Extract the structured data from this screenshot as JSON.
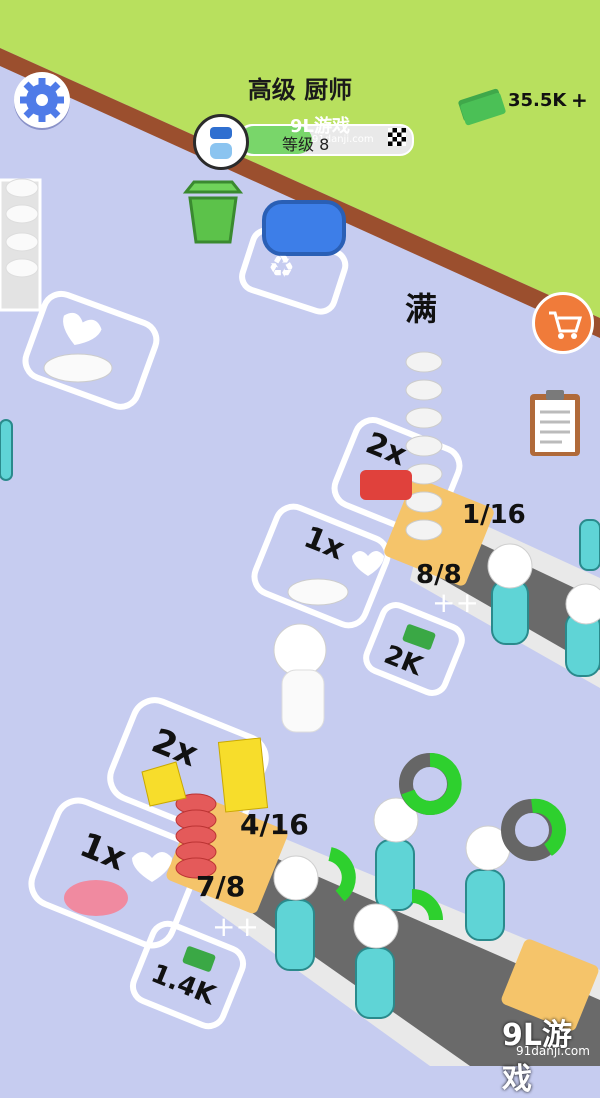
{
  "header": {
    "title": "高级 厨师",
    "rank_label": "等级 8",
    "rank_progress": 0.42,
    "money": "35.5K",
    "money_plus": "+"
  },
  "status": {
    "full_label": "满"
  },
  "stations": {
    "top_counter": "1/16",
    "top_tray": "8/8",
    "top_cost": "2K",
    "top_mult_a": "2x",
    "top_mult_b": "1x",
    "bottom_counter": "4/16",
    "bottom_tray": "7/8",
    "bottom_cost": "1.4K",
    "bottom_mult_a": "2x",
    "bottom_mult_b": "1x"
  },
  "watermark": {
    "top_logo": "9L游戏",
    "top_url": "91danji.com",
    "bottom_logo": "9L游戏",
    "bottom_url": "91danji.com"
  },
  "colors": {
    "floor": "#c6ccf0",
    "grass": "#b8e05e",
    "wall": "#9b4f2e",
    "accent_orange": "#f07b3a",
    "character": "#5fd4d6"
  },
  "icons": [
    "settings-gear-icon",
    "cash-stack-icon",
    "chef-hat-avatar-icon",
    "cart-icon",
    "clipboard-icon",
    "trash-bin-icon",
    "recycle-icon",
    "chicken-icon",
    "steak-icon",
    "cheese-icon",
    "cash-icon",
    "heart-icon"
  ]
}
